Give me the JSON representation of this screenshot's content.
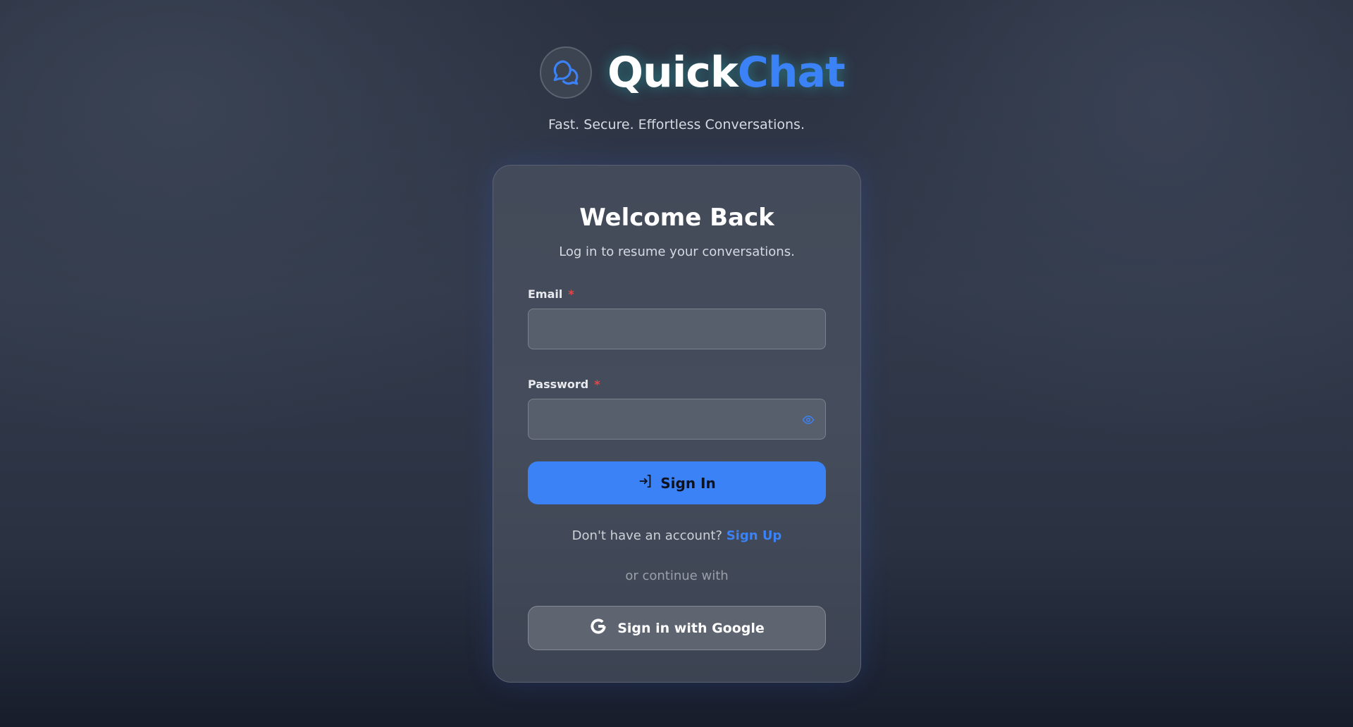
{
  "brand": {
    "name_part1": "Quick",
    "name_part2": "Chat",
    "tagline": "Fast. Secure. Effortless Conversations.",
    "accent": "#3b82f6"
  },
  "card": {
    "title": "Welcome Back",
    "subtitle": "Log in to resume your conversations.",
    "email": {
      "label": "Email",
      "required": "*",
      "value": "",
      "placeholder": ""
    },
    "password": {
      "label": "Password",
      "required": "*",
      "value": "",
      "placeholder": ""
    },
    "sign_in_label": "Sign In",
    "signup_prompt": "Don't have an account?",
    "signup_link": "Sign Up",
    "divider_text": "or continue with",
    "google_label": "Sign in with Google"
  }
}
